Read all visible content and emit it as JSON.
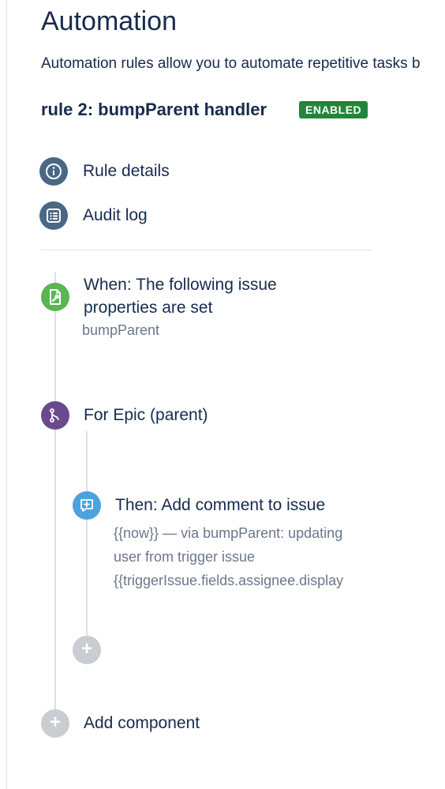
{
  "page": {
    "title": "Automation",
    "description": "Automation rules allow you to automate repetitive tasks b"
  },
  "rule": {
    "name": "rule 2: bumpParent handler",
    "status": "ENABLED"
  },
  "nav": {
    "items": [
      {
        "label": "Rule details",
        "icon": "info-icon"
      },
      {
        "label": "Audit log",
        "icon": "list-icon"
      }
    ]
  },
  "flow": {
    "trigger": {
      "title": "When: The following issue properties are set",
      "title_line1": "When: The following issue",
      "title_line2": "properties are set",
      "detail": "bumpParent",
      "icon": "issue-property-icon",
      "color": "#5ab552"
    },
    "branch": {
      "title": "For Epic (parent)",
      "icon": "branch-icon",
      "color": "#6a4a8c"
    },
    "action": {
      "title": "Then: Add comment to issue",
      "detail_line1": "{{now}} — via bumpParent: updating",
      "detail_line2": "user from trigger issue",
      "detail_line3": "{{triggerIssue.fields.assignee.display",
      "icon": "add-comment-icon",
      "color": "#4aa3df"
    },
    "add_component_label": "Add component"
  }
}
